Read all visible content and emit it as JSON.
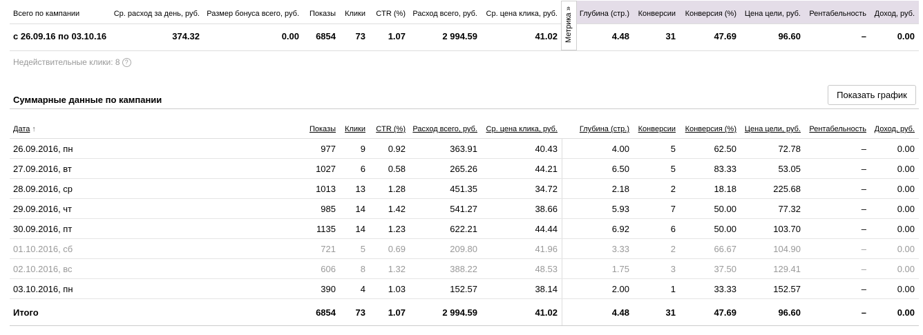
{
  "summary": {
    "headers": {
      "total_label": "Всего по кампании",
      "avg_daily": "Ср. расход за день, руб.",
      "bonus": "Размер бонуса всего, руб.",
      "impressions": "Показы",
      "clicks": "Клики",
      "ctr": "CTR (%)",
      "spend": "Расход всего, руб.",
      "cpc": "Ср. цена клика, руб.",
      "depth": "Глубина (стр.)",
      "conversions": "Конверсии",
      "conv_rate": "Конверсия (%)",
      "goal_cost": "Цена цели, руб.",
      "profitability": "Рентабельность",
      "income": "Доход, руб."
    },
    "values": {
      "period": "с 26.09.16 по 03.10.16",
      "avg_daily": "374.32",
      "bonus": "0.00",
      "impressions": "6854",
      "clicks": "73",
      "ctr": "1.07",
      "spend": "2 994.59",
      "cpc": "41.02",
      "depth": "4.48",
      "conversions": "31",
      "conv_rate": "47.69",
      "goal_cost": "96.60",
      "profitability": "–",
      "income": "0.00"
    },
    "metrika_tab": "Метрика »",
    "invalid_clicks": "Недействительные клики: 8",
    "help_icon": "?"
  },
  "daily": {
    "section_title": "Суммарные данные по кампании",
    "show_chart_button": "Показать график",
    "headers": {
      "date": "Дата",
      "sort_arrow": "↑",
      "impressions": "Показы",
      "clicks": "Клики",
      "ctr": "CTR (%)",
      "spend": "Расход всего, руб.",
      "cpc": "Ср. цена клика, руб.",
      "depth": "Глубина (стр.)",
      "conversions": "Конверсии",
      "conv_rate": "Конверсия (%)",
      "goal_cost": "Цена цели, руб.",
      "profitability": "Рентабельность",
      "income": "Доход, руб."
    },
    "rows": [
      {
        "date": "26.09.2016, пн",
        "impressions": "977",
        "clicks": "9",
        "ctr": "0.92",
        "spend": "363.91",
        "cpc": "40.43",
        "depth": "4.00",
        "conversions": "5",
        "conv_rate": "62.50",
        "goal_cost": "72.78",
        "profitability": "–",
        "income": "0.00",
        "weekend": false
      },
      {
        "date": "27.09.2016, вт",
        "impressions": "1027",
        "clicks": "6",
        "ctr": "0.58",
        "spend": "265.26",
        "cpc": "44.21",
        "depth": "6.50",
        "conversions": "5",
        "conv_rate": "83.33",
        "goal_cost": "53.05",
        "profitability": "–",
        "income": "0.00",
        "weekend": false
      },
      {
        "date": "28.09.2016, ср",
        "impressions": "1013",
        "clicks": "13",
        "ctr": "1.28",
        "spend": "451.35",
        "cpc": "34.72",
        "depth": "2.18",
        "conversions": "2",
        "conv_rate": "18.18",
        "goal_cost": "225.68",
        "profitability": "–",
        "income": "0.00",
        "weekend": false
      },
      {
        "date": "29.09.2016, чт",
        "impressions": "985",
        "clicks": "14",
        "ctr": "1.42",
        "spend": "541.27",
        "cpc": "38.66",
        "depth": "5.93",
        "conversions": "7",
        "conv_rate": "50.00",
        "goal_cost": "77.32",
        "profitability": "–",
        "income": "0.00",
        "weekend": false
      },
      {
        "date": "30.09.2016, пт",
        "impressions": "1135",
        "clicks": "14",
        "ctr": "1.23",
        "spend": "622.21",
        "cpc": "44.44",
        "depth": "6.92",
        "conversions": "6",
        "conv_rate": "50.00",
        "goal_cost": "103.70",
        "profitability": "–",
        "income": "0.00",
        "weekend": false
      },
      {
        "date": "01.10.2016, сб",
        "impressions": "721",
        "clicks": "5",
        "ctr": "0.69",
        "spend": "209.80",
        "cpc": "41.96",
        "depth": "3.33",
        "conversions": "2",
        "conv_rate": "66.67",
        "goal_cost": "104.90",
        "profitability": "–",
        "income": "0.00",
        "weekend": true
      },
      {
        "date": "02.10.2016, вс",
        "impressions": "606",
        "clicks": "8",
        "ctr": "1.32",
        "spend": "388.22",
        "cpc": "48.53",
        "depth": "1.75",
        "conversions": "3",
        "conv_rate": "37.50",
        "goal_cost": "129.41",
        "profitability": "–",
        "income": "0.00",
        "weekend": true
      },
      {
        "date": "03.10.2016, пн",
        "impressions": "390",
        "clicks": "4",
        "ctr": "1.03",
        "spend": "152.57",
        "cpc": "38.14",
        "depth": "2.00",
        "conversions": "1",
        "conv_rate": "33.33",
        "goal_cost": "152.57",
        "profitability": "–",
        "income": "0.00",
        "weekend": false
      }
    ],
    "total": {
      "date": "Итого",
      "impressions": "6854",
      "clicks": "73",
      "ctr": "1.07",
      "spend": "2 994.59",
      "cpc": "41.02",
      "depth": "4.48",
      "conversions": "31",
      "conv_rate": "47.69",
      "goal_cost": "96.60",
      "profitability": "–",
      "income": "0.00"
    }
  }
}
